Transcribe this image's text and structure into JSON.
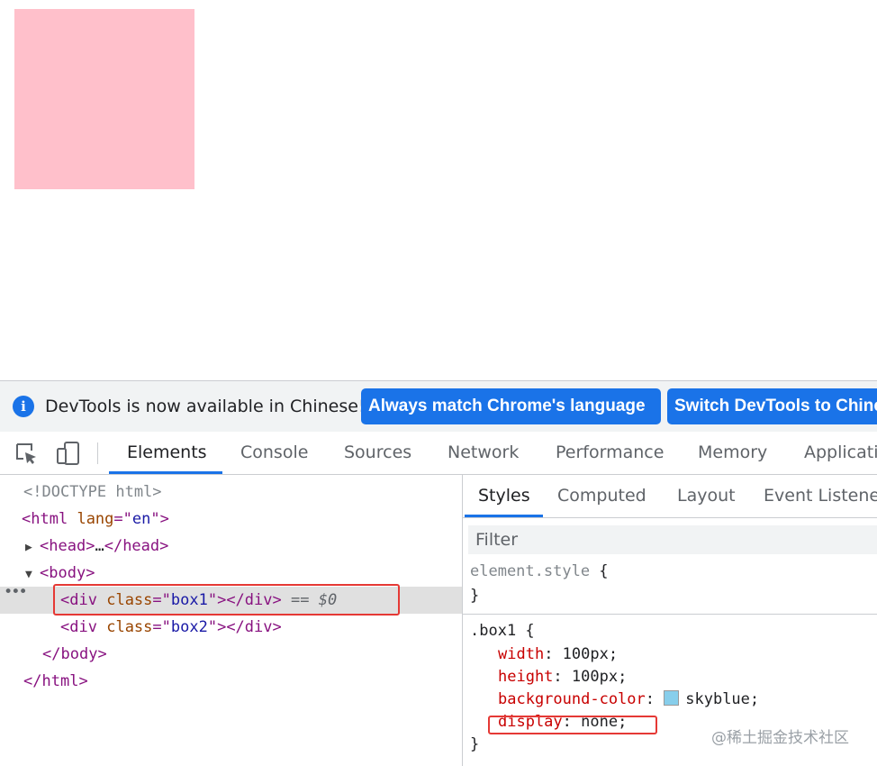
{
  "page": {
    "box1_color": "#ffc0cb"
  },
  "infobar": {
    "message": "DevTools is now available in Chinese!",
    "button_match": "Always match Chrome's language",
    "button_switch": "Switch DevTools to Chinese",
    "accent": "#1a73e8"
  },
  "tabs": [
    "Elements",
    "Console",
    "Sources",
    "Network",
    "Performance",
    "Memory",
    "Application"
  ],
  "dom": {
    "doctype": "<!DOCTYPE html>",
    "html_open": {
      "tag": "html",
      "attr": "lang",
      "value": "en"
    },
    "head": {
      "tag": "head",
      "ellipsis": "…"
    },
    "body_tag": "body",
    "div1": {
      "tag": "div",
      "attr": "class",
      "value": "box1",
      "suffix": "== $0"
    },
    "div2": {
      "tag": "div",
      "attr": "class",
      "value": "box2"
    }
  },
  "styles": {
    "subtabs": [
      "Styles",
      "Computed",
      "Layout",
      "Event Listeners"
    ],
    "filter_placeholder": "Filter",
    "element_style_selector": "element.style",
    "rule_selector": ".box1",
    "declarations": [
      {
        "prop": "width",
        "value": "100px;"
      },
      {
        "prop": "height",
        "value": "100px;"
      },
      {
        "prop": "background-color",
        "value": "skyblue;",
        "swatch": "#87ceeb"
      },
      {
        "prop": "display",
        "value": "none;"
      }
    ]
  },
  "watermark": "@稀土掘金技术社区"
}
